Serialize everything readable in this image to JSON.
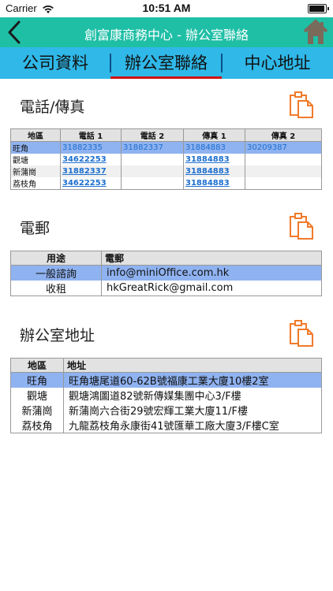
{
  "status_bar": {
    "carrier": "Carrier",
    "time": "10:51 AM"
  },
  "nav": {
    "title": "創富康商務中心 - 辦公室聯絡"
  },
  "tabs": [
    {
      "label": "公司資料"
    },
    {
      "label": "辦公室聯絡"
    },
    {
      "label": "中心地址"
    }
  ],
  "phone_fax": {
    "title": "電話/傳真",
    "headers": [
      "地區",
      "電話 1",
      "電話 2",
      "傳真 1",
      "傳真 2"
    ],
    "rows": [
      [
        "旺角",
        "31882335",
        "31882337",
        "31884883",
        "30209387"
      ],
      [
        "觀塘",
        "34622253",
        "",
        "31884883",
        ""
      ],
      [
        "新蒲崗",
        "31882337",
        "",
        "31884883",
        ""
      ],
      [
        "荔枝角",
        "34622253",
        "",
        "31884883",
        ""
      ]
    ]
  },
  "email": {
    "title": "電郵",
    "headers": [
      "用途",
      "電郵"
    ],
    "rows": [
      [
        "一般諮詢",
        "info@miniOffice.com.hk"
      ],
      [
        "收租",
        "hkGreatRick@gmail.com"
      ]
    ]
  },
  "address": {
    "title": "辦公室地址",
    "headers": [
      "地區",
      "地址"
    ],
    "rows": [
      [
        "旺角",
        "旺角塘尾道60-62B號福康工業大廈10樓2室"
      ],
      [
        "觀塘",
        "觀塘鴻圖道82號新傳媒集團中心3/F樓"
      ],
      [
        "新蒲崗",
        "新蒲崗六合街29號宏輝工業大廈11/F樓"
      ],
      [
        "荔枝角",
        "九龍荔枝角永康街41號匯華工廠大廈3/F樓C室"
      ]
    ]
  },
  "icons": [
    "wifi-icon",
    "battery-icon",
    "back-chevron-icon",
    "home-icon",
    "copy-icon"
  ],
  "colors": {
    "nav": "#1fbfa6",
    "tabbar": "#2fb8e8",
    "active_tab_underline": "#d01010",
    "row_highlight": "#8fb2f0",
    "copy_icon": "#f07a2a",
    "link": "#1d6fcf"
  }
}
